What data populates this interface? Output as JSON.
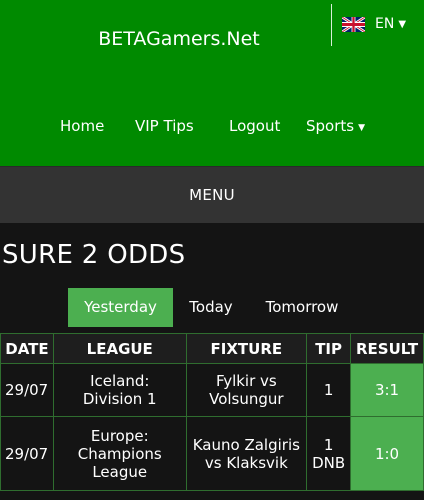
{
  "header": {
    "site_title": "BETAGamers.Net",
    "language": {
      "code": "EN",
      "icon": "uk-flag-icon"
    },
    "nav": [
      {
        "label": "Home"
      },
      {
        "label": "VIP Tips"
      },
      {
        "label": "Logout"
      },
      {
        "label": "Sports",
        "has_dropdown": true
      }
    ],
    "background_color": "#008a00"
  },
  "menu_bar": {
    "label": "MENU"
  },
  "page_title": "SURE 2 ODDS",
  "day_tabs": [
    {
      "label": "Yesterday",
      "active": true
    },
    {
      "label": "Today",
      "active": false
    },
    {
      "label": "Tomorrow",
      "active": false
    }
  ],
  "table": {
    "headers": [
      "DATE",
      "LEAGUE",
      "FIXTURE",
      "TIP",
      "RESULT"
    ],
    "rows": [
      {
        "date": "29/07",
        "league": [
          "Iceland:",
          "Division 1"
        ],
        "fixture": [
          "Fylkir vs",
          "Volsungur"
        ],
        "tip": [
          "1"
        ],
        "result": "3:1"
      },
      {
        "date": "29/07",
        "league": [
          "Europe:",
          "Champions",
          "League"
        ],
        "fixture": [
          "Kauno Zalgiris",
          "vs Klaksvik"
        ],
        "tip": [
          "1",
          "DNB"
        ],
        "result": "1:0"
      }
    ]
  },
  "colors": {
    "accent_green": "#4caf50",
    "menu_bar": "#333333",
    "page_bg": "#141414"
  }
}
